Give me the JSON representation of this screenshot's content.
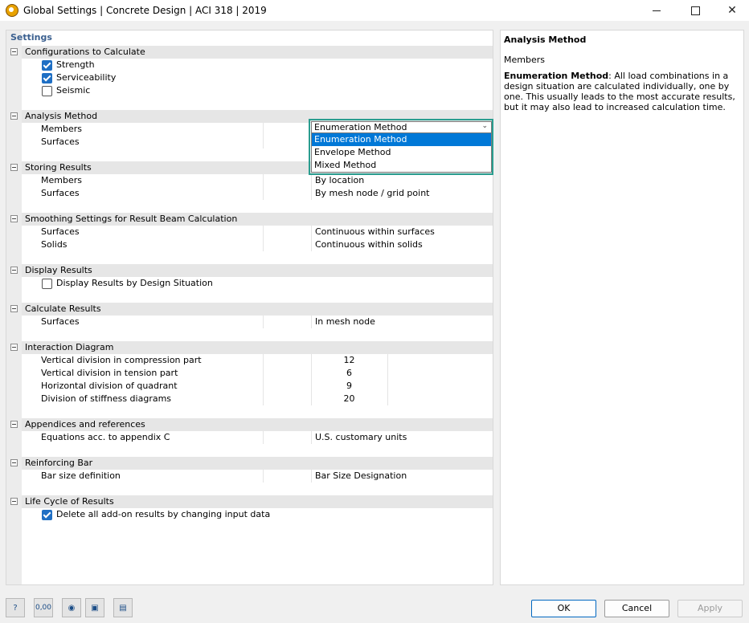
{
  "window": {
    "title": "Global Settings | Concrete Design | ACI 318 | 2019"
  },
  "left": {
    "header": "Settings",
    "configurations": {
      "title": "Configurations to Calculate",
      "strength": "Strength",
      "serviceability": "Serviceability",
      "seismic": "Seismic"
    },
    "analysis": {
      "title": "Analysis Method",
      "members": "Members",
      "surfaces": "Surfaces"
    },
    "storing": {
      "title": "Storing Results",
      "members": "Members",
      "members_val": "By location",
      "surfaces": "Surfaces",
      "surfaces_val": "By mesh node / grid point"
    },
    "smoothing": {
      "title": "Smoothing Settings for Result Beam Calculation",
      "surfaces": "Surfaces",
      "surfaces_val": "Continuous within surfaces",
      "solids": "Solids",
      "solids_val": "Continuous within solids"
    },
    "display": {
      "title": "Display Results",
      "by_ds": "Display Results by Design Situation"
    },
    "calculate": {
      "title": "Calculate Results",
      "surfaces": "Surfaces",
      "surfaces_val": "In mesh node"
    },
    "interaction": {
      "title": "Interaction Diagram",
      "vc": "Vertical division in compression part",
      "vc_val": "12",
      "vt": "Vertical division in tension part",
      "vt_val": "6",
      "hq": "Horizontal division of quadrant",
      "hq_val": "9",
      "ds": "Division of stiffness diagrams",
      "ds_val": "20"
    },
    "appendices": {
      "title": "Appendices and references",
      "eq": "Equations acc. to appendix C",
      "eq_val": "U.S. customary units"
    },
    "reinforcing": {
      "title": "Reinforcing Bar",
      "bsd": "Bar size definition",
      "bsd_val": "Bar Size Designation"
    },
    "lifecycle": {
      "title": "Life Cycle of Results",
      "delete": "Delete all add-on results by changing input data"
    }
  },
  "dropdown": {
    "selected": "Enumeration Method",
    "options": [
      "Enumeration Method",
      "Envelope Method",
      "Mixed Method"
    ]
  },
  "right": {
    "title": "Analysis Method",
    "sub": "Members",
    "desc_bold": "Enumeration Method",
    "desc_rest": ": All load combinations in a design situation are calculated individually, one by one. This usually leads to the most accurate results, but it may also lead to increased calculation time."
  },
  "bottom_icons": [
    "help-icon",
    "units-icon",
    "view-icon",
    "save-icon",
    "library-icon"
  ],
  "bottom_icon_labels": {
    "units": "0,00"
  },
  "buttons": {
    "ok": "OK",
    "cancel": "Cancel",
    "apply": "Apply"
  }
}
